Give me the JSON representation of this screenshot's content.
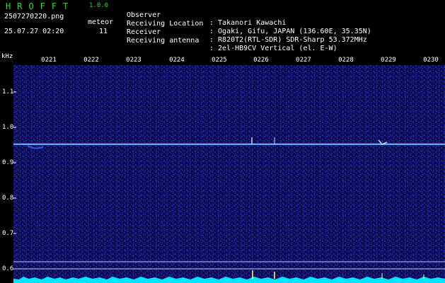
{
  "header": {
    "brand": "HROFFT",
    "version": "1.0.0",
    "filename": "2507270220.png",
    "datetime": "25.07.27 02:20",
    "meteor_label": "meteor",
    "meteor_count": "11"
  },
  "station": [
    {
      "label": "Observer",
      "value": ": Takanori Kawachi"
    },
    {
      "label": "Receiving Location",
      "value": ": Ogaki, Gifu, JAPAN (136.60E, 35.35N)"
    },
    {
      "label": "Receiver",
      "value": ": R820T2(RTL-SDR) SDR-Sharp 53.372MHz"
    },
    {
      "label": "Receiving antenna",
      "value": ": 2el-HB9CV Vertical (el. E-W)"
    }
  ],
  "axes": {
    "frequency_unit": "kHz",
    "time_ticks": [
      "0221",
      "0222",
      "0223",
      "0224",
      "0225",
      "0226",
      "0227",
      "0228",
      "0229",
      "0230"
    ],
    "freq_ticks": [
      "1.1",
      "1.0",
      "0.9",
      "0.8",
      "0.7",
      "0.6"
    ]
  },
  "colors": {
    "header_green": "#22dd22",
    "text_white": "#ffffff",
    "noise_dark": "#0a0a3a",
    "noise_mid": "#1e1ea8",
    "signal_line": "#4aa8ff",
    "baseline": "#00e5ff",
    "marker_yellow": "#ffff66"
  }
}
